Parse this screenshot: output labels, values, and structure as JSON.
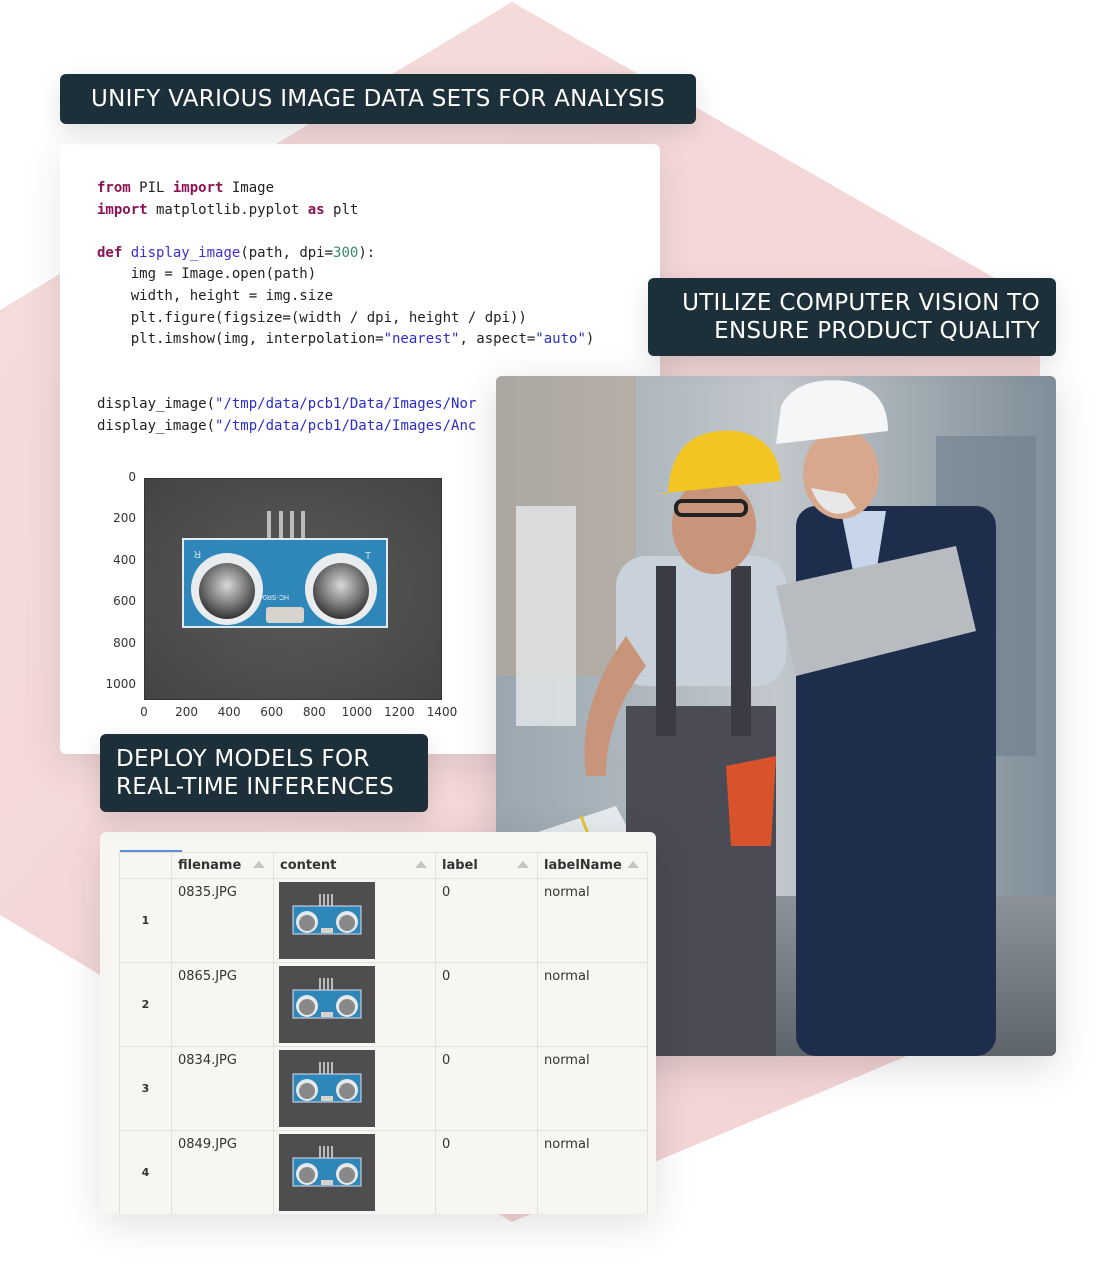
{
  "background": {
    "accent_color": "#f4d9da",
    "tag_color": "#1d2f38"
  },
  "tags": {
    "unify": "UNIFY VARIOUS IMAGE DATA SETS FOR ANALYSIS",
    "utilize_line1": "UTILIZE COMPUTER VISION TO",
    "utilize_line2": "ENSURE PRODUCT QUALITY",
    "deploy_line1": "DEPLOY MODELS FOR",
    "deploy_line2": "REAL-TIME INFERENCES"
  },
  "code": {
    "lines": [
      [
        {
          "t": "from",
          "c": "kw"
        },
        {
          "t": " PIL "
        },
        {
          "t": "import",
          "c": "kw"
        },
        {
          "t": " Image"
        }
      ],
      [
        {
          "t": "import",
          "c": "kw"
        },
        {
          "t": " matplotlib.pyplot "
        },
        {
          "t": "as",
          "c": "kw"
        },
        {
          "t": " plt"
        }
      ],
      [],
      [
        {
          "t": "def",
          "c": "kw"
        },
        {
          "t": " "
        },
        {
          "t": "display_image",
          "c": "fn"
        },
        {
          "t": "(path, dpi="
        },
        {
          "t": "300",
          "c": "num"
        },
        {
          "t": "):"
        }
      ],
      [
        {
          "t": "    img = Image.open(path)"
        }
      ],
      [
        {
          "t": "    width, height = img.size"
        }
      ],
      [
        {
          "t": "    plt.figure(figsize=(width / dpi, height / dpi))"
        }
      ],
      [
        {
          "t": "    plt.imshow(img, interpolation="
        },
        {
          "t": "\"nearest\"",
          "c": "str"
        },
        {
          "t": ", aspect="
        },
        {
          "t": "\"auto\"",
          "c": "str"
        },
        {
          "t": ")"
        }
      ],
      [],
      [],
      [
        {
          "t": "display_image("
        },
        {
          "t": "\"/tmp/data/pcb1/Data/Images/Nor",
          "c": "str"
        }
      ],
      [
        {
          "t": "display_image("
        },
        {
          "t": "\"/tmp/data/pcb1/Data/Images/Anc",
          "c": "str"
        }
      ]
    ]
  },
  "plot": {
    "y_ticks": [
      "0",
      "200",
      "400",
      "600",
      "800",
      "1000"
    ],
    "x_ticks": [
      "0",
      "200",
      "400",
      "600",
      "800",
      "1000",
      "1200",
      "1400"
    ],
    "image_subject": "HC-SR04 ultrasonic sensor",
    "board_labels": {
      "left": "R",
      "right": "T",
      "model": "HC-SR04"
    }
  },
  "photo": {
    "alt": "Two workers in hard hats inspecting product in a factory, one holding a laptop"
  },
  "table": {
    "columns": [
      "",
      "filename",
      "content",
      "label",
      "labelName"
    ],
    "rows": [
      {
        "index": "1",
        "filename": "0835.JPG",
        "label": "0",
        "labelName": "normal"
      },
      {
        "index": "2",
        "filename": "0865.JPG",
        "label": "0",
        "labelName": "normal"
      },
      {
        "index": "3",
        "filename": "0834.JPG",
        "label": "0",
        "labelName": "normal"
      },
      {
        "index": "4",
        "filename": "0849.JPG",
        "label": "0",
        "labelName": "normal"
      }
    ]
  }
}
